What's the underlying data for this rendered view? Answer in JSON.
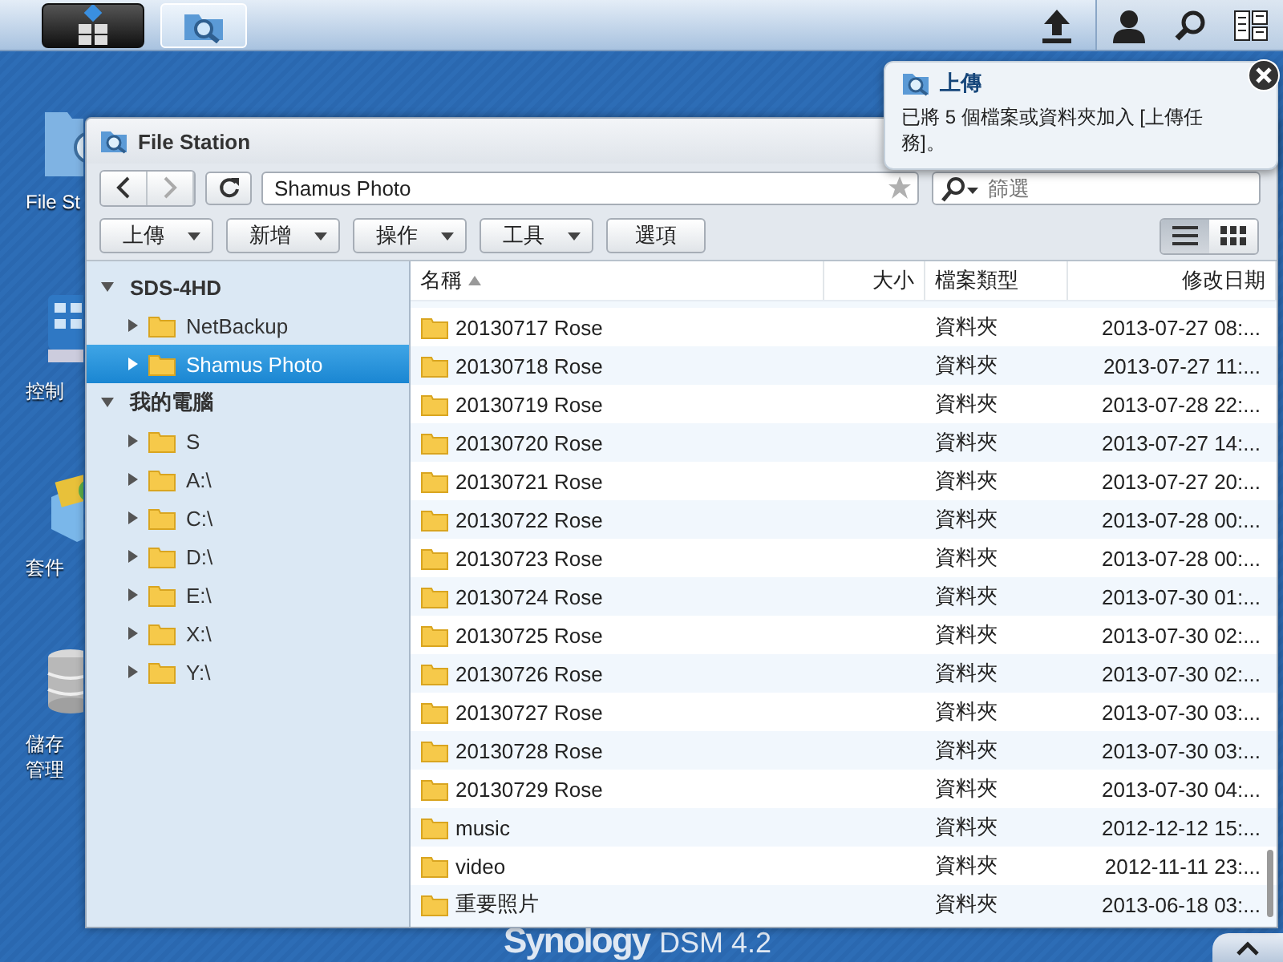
{
  "desktop_icons": [
    {
      "kind": "folder",
      "lines": [
        "File St"
      ]
    },
    {
      "kind": "control",
      "lines": [
        "控制"
      ]
    },
    {
      "kind": "package",
      "lines": [
        "套件"
      ]
    },
    {
      "kind": "storage",
      "lines": [
        "儲存",
        "管理"
      ]
    }
  ],
  "window": {
    "title": "File Station",
    "path": "Shamus Photo",
    "filter": {
      "placeholder": "篩選"
    },
    "toolbar": [
      {
        "label": "上傳",
        "dropdown": true
      },
      {
        "label": "新增",
        "dropdown": true
      },
      {
        "label": "操作",
        "dropdown": true
      },
      {
        "label": "工具",
        "dropdown": true
      },
      {
        "label": "選項",
        "dropdown": false
      }
    ],
    "view_modes": [
      {
        "kind": "list",
        "selected": true
      },
      {
        "kind": "grid",
        "selected": false
      }
    ],
    "tree": [
      {
        "label": "SDS-4HD",
        "expanded": true,
        "children": [
          {
            "label": "NetBackup",
            "selected": false
          },
          {
            "label": "Shamus Photo",
            "selected": true
          }
        ]
      },
      {
        "label": "我的電腦",
        "expanded": true,
        "children": [
          {
            "label": "S",
            "selected": false
          },
          {
            "label": "A:\\",
            "selected": false
          },
          {
            "label": "C:\\",
            "selected": false
          },
          {
            "label": "D:\\",
            "selected": false
          },
          {
            "label": "E:\\",
            "selected": false
          },
          {
            "label": "X:\\",
            "selected": false
          },
          {
            "label": "Y:\\",
            "selected": false
          }
        ]
      }
    ],
    "table": {
      "columns": [
        {
          "label": "名稱",
          "sorted": true
        },
        {
          "label": "大小",
          "sorted": false
        },
        {
          "label": "檔案類型",
          "sorted": false
        },
        {
          "label": "修改日期",
          "sorted": false
        }
      ],
      "rows": [
        {
          "name": "20130717 Rose",
          "type": "資料夾",
          "modified": "2013-07-27 08:..."
        },
        {
          "name": "20130718 Rose",
          "type": "資料夾",
          "modified": "2013-07-27 11:..."
        },
        {
          "name": "20130719 Rose",
          "type": "資料夾",
          "modified": "2013-07-28 22:..."
        },
        {
          "name": "20130720 Rose",
          "type": "資料夾",
          "modified": "2013-07-27 14:..."
        },
        {
          "name": "20130721 Rose",
          "type": "資料夾",
          "modified": "2013-07-27 20:..."
        },
        {
          "name": "20130722 Rose",
          "type": "資料夾",
          "modified": "2013-07-28 00:..."
        },
        {
          "name": "20130723 Rose",
          "type": "資料夾",
          "modified": "2013-07-28 00:..."
        },
        {
          "name": "20130724 Rose",
          "type": "資料夾",
          "modified": "2013-07-30 01:..."
        },
        {
          "name": "20130725 Rose",
          "type": "資料夾",
          "modified": "2013-07-30 02:..."
        },
        {
          "name": "20130726 Rose",
          "type": "資料夾",
          "modified": "2013-07-30 02:..."
        },
        {
          "name": "20130727 Rose",
          "type": "資料夾",
          "modified": "2013-07-30 03:..."
        },
        {
          "name": "20130728 Rose",
          "type": "資料夾",
          "modified": "2013-07-30 03:..."
        },
        {
          "name": "20130729 Rose",
          "type": "資料夾",
          "modified": "2013-07-30 04:..."
        },
        {
          "name": "music",
          "type": "資料夾",
          "modified": "2012-12-12 15:..."
        },
        {
          "name": "video",
          "type": "資料夾",
          "modified": "2012-11-11 23:..."
        },
        {
          "name": "重要照片",
          "type": "資料夾",
          "modified": "2013-06-18 03:..."
        }
      ]
    }
  },
  "notification": {
    "title": "上傳",
    "message": "已將 5 個檔案或資料夾加入 [上傳任務]。"
  },
  "brand": {
    "name": "Synology",
    "product": "DSM 4.2"
  }
}
